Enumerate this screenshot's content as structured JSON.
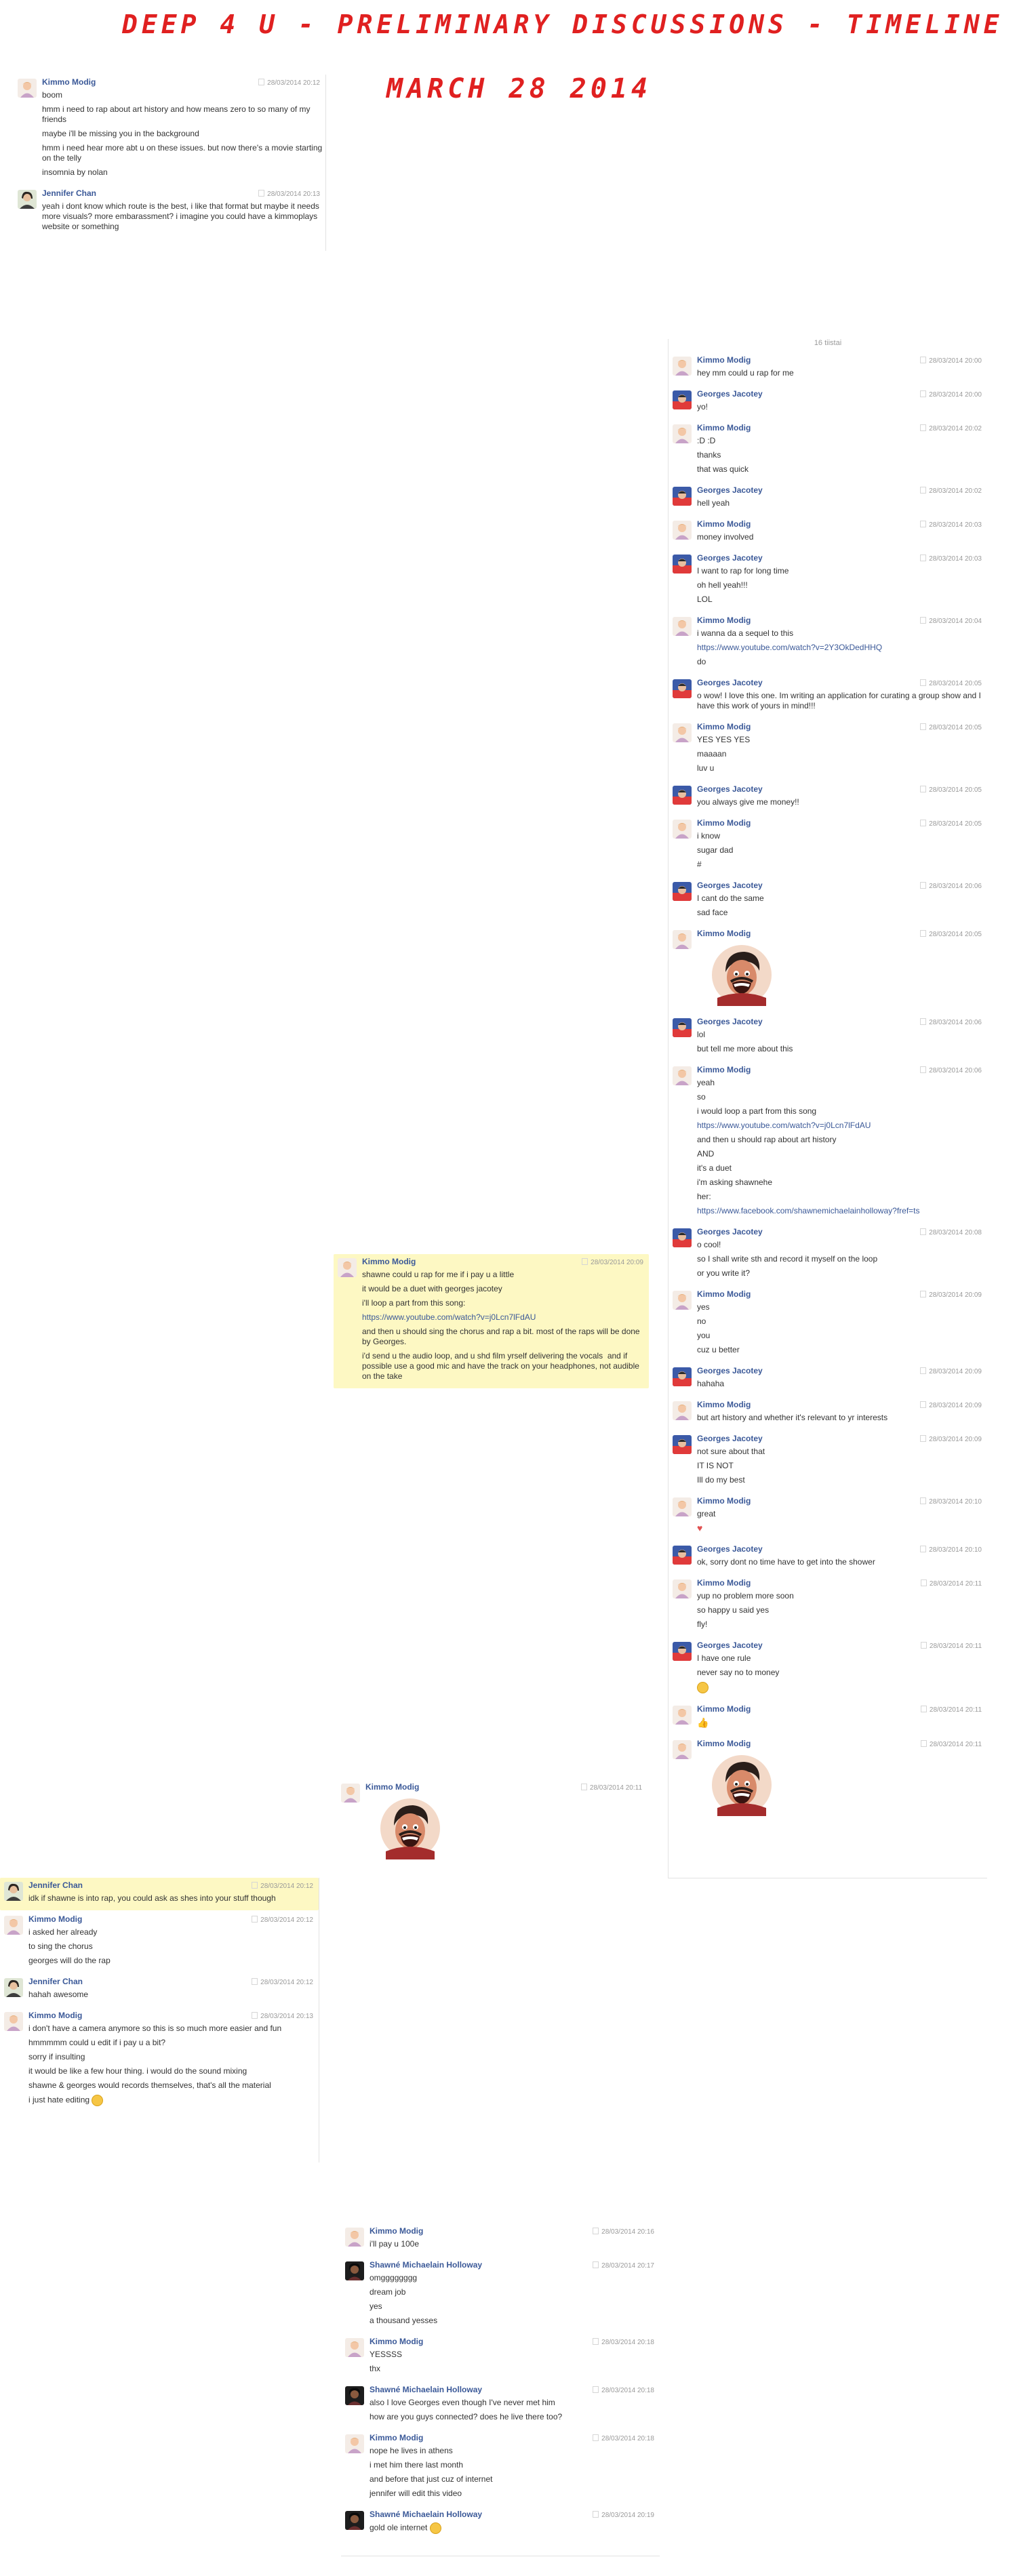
{
  "title": "DEEP 4 U - PRELIMINARY DISCUSSIONS - TIMELINE",
  "date": "MARCH 28 2014",
  "colors": {
    "accent": "#e02020",
    "name_link": "#3b5998",
    "highlight": "#fdf8c3",
    "timestamp": "#9a9a9a"
  },
  "chats": [
    {
      "day_label": "",
      "messages": [
        {
          "sender": "Kimmo Modig",
          "avatar": "kimmo",
          "time": "28/03/2014 20:12",
          "lines": [
            {
              "text": "boom"
            },
            {
              "text": "hmm i need to rap about art history and how means zero to so many of my friends"
            },
            {
              "text": "maybe i'll be missing you in the background"
            },
            {
              "text": "hmm i need hear more abt u on these issues. but now there's a movie starting on the telly"
            },
            {
              "text": "insomnia by nolan"
            }
          ]
        },
        {
          "sender": "Jennifer Chan",
          "avatar": "jennifer",
          "time": "28/03/2014 20:13",
          "lines": [
            {
              "text": "yeah i dont know which route is the best, i like that format but maybe it needs more visuals? more embarassment? i imagine you could have a kimmoplays website or something"
            }
          ]
        }
      ]
    },
    {
      "day_label": "16 tiistai",
      "messages": [
        {
          "sender": "Kimmo Modig",
          "avatar": "kimmo",
          "time": "28/03/2014 20:00",
          "lines": [
            {
              "text": "hey mm could u rap for me"
            }
          ]
        },
        {
          "sender": "Georges Jacotey",
          "avatar": "georges",
          "time": "28/03/2014 20:00",
          "lines": [
            {
              "text": "yo!"
            }
          ]
        },
        {
          "sender": "Kimmo Modig",
          "avatar": "kimmo",
          "time": "28/03/2014 20:02",
          "lines": [
            {
              "text": ":D :D"
            },
            {
              "text": "thanks"
            },
            {
              "text": "that was quick"
            }
          ]
        },
        {
          "sender": "Georges Jacotey",
          "avatar": "georges",
          "time": "28/03/2014 20:02",
          "lines": [
            {
              "text": "hell yeah"
            }
          ]
        },
        {
          "sender": "Kimmo Modig",
          "avatar": "kimmo",
          "time": "28/03/2014 20:03",
          "lines": [
            {
              "text": "money involved"
            }
          ]
        },
        {
          "sender": "Georges Jacotey",
          "avatar": "georges",
          "time": "28/03/2014 20:03",
          "lines": [
            {
              "text": "I want to rap for long time"
            },
            {
              "text": "oh hell yeah!!!"
            },
            {
              "text": "LOL"
            }
          ]
        },
        {
          "sender": "Kimmo Modig",
          "avatar": "kimmo",
          "time": "28/03/2014 20:04",
          "lines": [
            {
              "text": "i wanna da a sequel to this"
            },
            {
              "text": "https://www.youtube.com/watch?v=2Y3OkDedHHQ",
              "link": true
            },
            {
              "text": "do"
            }
          ]
        },
        {
          "sender": "Georges Jacotey",
          "avatar": "georges",
          "time": "28/03/2014 20:05",
          "lines": [
            {
              "text": "o wow! I love this one. Im writing an application for curating a group show and I have this work of yours in mind!!!"
            }
          ]
        },
        {
          "sender": "Kimmo Modig",
          "avatar": "kimmo",
          "time": "28/03/2014 20:05",
          "lines": [
            {
              "text": "YES YES YES"
            },
            {
              "text": "maaaan"
            },
            {
              "text": "luv u"
            }
          ]
        },
        {
          "sender": "Georges Jacotey",
          "avatar": "georges",
          "time": "28/03/2014 20:05",
          "lines": [
            {
              "text": "you always give me money!!"
            }
          ]
        },
        {
          "sender": "Kimmo Modig",
          "avatar": "kimmo",
          "time": "28/03/2014 20:05",
          "lines": [
            {
              "text": "i know"
            },
            {
              "text": "sugar dad"
            },
            {
              "text": "#"
            }
          ]
        },
        {
          "sender": "Georges Jacotey",
          "avatar": "georges",
          "time": "28/03/2014 20:06",
          "lines": [
            {
              "text": "I cant do the same"
            },
            {
              "text": "sad face"
            }
          ]
        },
        {
          "sender": "Kimmo Modig",
          "avatar": "kimmo",
          "time": "28/03/2014 20:05",
          "sticker": true,
          "lines": []
        },
        {
          "sender": "Georges Jacotey",
          "avatar": "georges",
          "time": "28/03/2014 20:06",
          "lines": [
            {
              "text": "lol"
            },
            {
              "text": "but tell me more about this"
            }
          ]
        },
        {
          "sender": "Kimmo Modig",
          "avatar": "kimmo",
          "time": "28/03/2014 20:06",
          "lines": [
            {
              "text": "yeah"
            },
            {
              "text": "so"
            },
            {
              "text": "i would loop a part from this song"
            },
            {
              "text": "https://www.youtube.com/watch?v=j0Lcn7lFdAU",
              "link": true
            },
            {
              "text": "and then u should rap about art history"
            },
            {
              "text": "AND"
            },
            {
              "text": "it's a duet"
            },
            {
              "text": "i'm asking shawnehe"
            },
            {
              "text": "her:"
            },
            {
              "text": "https://www.facebook.com/shawnemichaelainholloway?fref=ts",
              "link": true
            }
          ]
        },
        {
          "sender": "Georges Jacotey",
          "avatar": "georges",
          "time": "28/03/2014 20:08",
          "lines": [
            {
              "text": "o cool!"
            },
            {
              "text": "so I shall write sth and record it myself on the loop"
            },
            {
              "text": "or you write it?"
            }
          ]
        },
        {
          "sender": "Kimmo Modig",
          "avatar": "kimmo",
          "time": "28/03/2014 20:09",
          "lines": [
            {
              "text": "yes"
            },
            {
              "text": "no"
            },
            {
              "text": "you"
            },
            {
              "text": "cuz u better"
            }
          ]
        },
        {
          "sender": "Georges Jacotey",
          "avatar": "georges",
          "time": "28/03/2014 20:09",
          "lines": [
            {
              "text": "hahaha"
            }
          ]
        },
        {
          "sender": "Kimmo Modig",
          "avatar": "kimmo",
          "time": "28/03/2014 20:09",
          "lines": [
            {
              "text": "but art history and whether it's relevant to yr interests"
            }
          ]
        },
        {
          "sender": "Georges Jacotey",
          "avatar": "georges",
          "time": "28/03/2014 20:09",
          "lines": [
            {
              "text": "not sure about that"
            },
            {
              "text": "IT IS NOT"
            },
            {
              "text": "Ill do my best"
            }
          ]
        },
        {
          "sender": "Kimmo Modig",
          "avatar": "kimmo",
          "time": "28/03/2014 20:10",
          "lines": [
            {
              "text": "great"
            },
            {
              "text": "♥",
              "emoji": "heart"
            }
          ]
        },
        {
          "sender": "Georges Jacotey",
          "avatar": "georges",
          "time": "28/03/2014 20:10",
          "lines": [
            {
              "text": "ok, sorry dont no time have to get into the shower"
            }
          ]
        },
        {
          "sender": "Kimmo Modig",
          "avatar": "kimmo",
          "time": "28/03/2014 20:11",
          "lines": [
            {
              "text": "yup no problem more soon"
            },
            {
              "text": "so happy u said yes"
            },
            {
              "text": "fly!"
            }
          ]
        },
        {
          "sender": "Georges Jacotey",
          "avatar": "georges",
          "time": "28/03/2014 20:11",
          "lines": [
            {
              "text": "I have one rule"
            },
            {
              "text": "never say no to money"
            },
            {
              "text": "",
              "emoji": "smile"
            }
          ]
        },
        {
          "sender": "Kimmo Modig",
          "avatar": "kimmo",
          "time": "28/03/2014 20:11",
          "lines": [
            {
              "text": "👍",
              "emoji": "thumb"
            }
          ]
        },
        {
          "sender": "Kimmo Modig",
          "avatar": "kimmo",
          "time": "28/03/2014 20:11",
          "sticker": true,
          "lines": []
        }
      ]
    },
    {
      "day_label": "",
      "messages": [
        {
          "sender": "Kimmo Modig",
          "avatar": "kimmo",
          "time": "28/03/2014 20:09",
          "highlight": true,
          "lines": [
            {
              "text": "shawne could u rap for me if i pay u a little"
            },
            {
              "text": "it would be a duet with georges jacotey"
            },
            {
              "text": "i'll loop a part from this song:"
            },
            {
              "text": "https://www.youtube.com/watch?v=j0Lcn7lFdAU",
              "link": true
            },
            {
              "text": "and then u should sing the chorus and rap a bit. most of the raps will be done by Georges."
            },
            {
              "text": "i'd send u the audio loop, and u shd film yrself delivering the vocals  and if possible use a good mic and have the track on your headphones, not audible on the take"
            }
          ]
        }
      ]
    },
    {
      "day_label": "",
      "messages": [
        {
          "sender": "Kimmo Modig",
          "avatar": "kimmo",
          "time": "28/03/2014 20:11",
          "sticker": true,
          "lines": []
        }
      ]
    },
    {
      "day_label": "",
      "messages": [
        {
          "sender": "Jennifer Chan",
          "avatar": "jennifer",
          "time": "28/03/2014 20:12",
          "highlight": true,
          "lines": [
            {
              "text": "idk if shawne is into rap, you could ask as shes into your stuff though"
            }
          ]
        },
        {
          "sender": "Kimmo Modig",
          "avatar": "kimmo",
          "time": "28/03/2014 20:12",
          "lines": [
            {
              "text": "i asked her already"
            },
            {
              "text": "to sing the chorus"
            },
            {
              "text": "georges will do the rap"
            }
          ]
        },
        {
          "sender": "Jennifer Chan",
          "avatar": "jennifer",
          "time": "28/03/2014 20:12",
          "lines": [
            {
              "text": "hahah awesome"
            }
          ]
        },
        {
          "sender": "Kimmo Modig",
          "avatar": "kimmo",
          "time": "28/03/2014 20:13",
          "lines": [
            {
              "text": "i don't have a camera anymore so this is so much more easier and fun"
            },
            {
              "text": "hmmmmm could u edit if i pay u a bit?"
            },
            {
              "text": "sorry if insulting"
            },
            {
              "text": "it would be like a few hour thing. i would do the sound mixing"
            },
            {
              "text": "shawne & georges would records themselves, that's all the material"
            },
            {
              "text": "i just hate editing",
              "emoji": "smile"
            }
          ]
        }
      ]
    },
    {
      "day_label": "",
      "messages": [
        {
          "sender": "Kimmo Modig",
          "avatar": "kimmo",
          "time": "28/03/2014 20:16",
          "lines": [
            {
              "text": "i'll pay u 100e"
            }
          ]
        },
        {
          "sender": "Shawné Michaelain Holloway",
          "avatar": "shawne",
          "time": "28/03/2014 20:17",
          "lines": [
            {
              "text": "omgggggggg"
            },
            {
              "text": "dream job"
            },
            {
              "text": "yes"
            },
            {
              "text": "a thousand yesses"
            }
          ]
        },
        {
          "sender": "Kimmo Modig",
          "avatar": "kimmo",
          "time": "28/03/2014 20:18",
          "lines": [
            {
              "text": "YESSSS"
            },
            {
              "text": "thx"
            }
          ]
        },
        {
          "sender": "Shawné Michaelain Holloway",
          "avatar": "shawne",
          "time": "28/03/2014 20:18",
          "lines": [
            {
              "text": "also I love Georges even though I've never met him"
            },
            {
              "text": "how are you guys connected? does he live there too?"
            }
          ]
        },
        {
          "sender": "Kimmo Modig",
          "avatar": "kimmo",
          "time": "28/03/2014 20:18",
          "lines": [
            {
              "text": "nope he lives in athens"
            },
            {
              "text": "i met him there last month"
            },
            {
              "text": "and before that just cuz of internet"
            },
            {
              "text": "jennifer will edit this video"
            }
          ]
        },
        {
          "sender": "Shawné Michaelain Holloway",
          "avatar": "shawne",
          "time": "28/03/2014 20:19",
          "lines": [
            {
              "text": "gold ole internet",
              "emoji": "smile"
            }
          ]
        }
      ]
    }
  ]
}
